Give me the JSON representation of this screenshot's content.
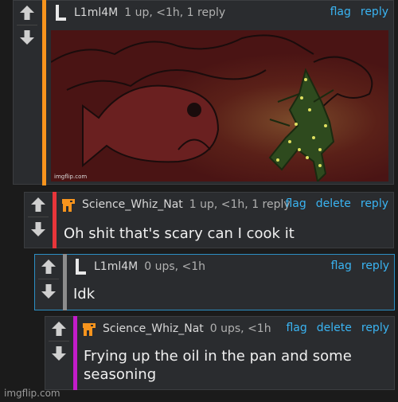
{
  "comments": [
    {
      "username": "L1ml4M",
      "meta": "1 up, <1h, 1 reply",
      "actions": [
        "flag",
        "reply"
      ],
      "bar_color": "#f7941d",
      "avatar": "letter-L-icon",
      "image_watermark": "imgflip.com"
    },
    {
      "username": "Science_Whiz_Nat",
      "meta": "1 up, <1h, 1 reply",
      "actions": [
        "flag",
        "delete",
        "reply"
      ],
      "bar_color": "#e8353a",
      "avatar": "pixel-creature-orange-icon",
      "text": "Oh shit that's scary can I cook it"
    },
    {
      "username": "L1ml4M",
      "meta": "0 ups, <1h",
      "actions": [
        "flag",
        "reply"
      ],
      "bar_color": "#8c8c8c",
      "avatar": "letter-L-icon",
      "text": "Idk"
    },
    {
      "username": "Science_Whiz_Nat",
      "meta": "0 ups, <1h",
      "actions": [
        "flag",
        "delete",
        "reply"
      ],
      "bar_color": "#c21cc9",
      "avatar": "pixel-creature-orange-icon",
      "text": "Frying up the oil in the pan and some seasoning"
    }
  ],
  "footer_watermark": "imgflip.com",
  "colors": {
    "link": "#3ab4f2",
    "background": "#1b1b1b",
    "panel": "#2a2c2f"
  }
}
